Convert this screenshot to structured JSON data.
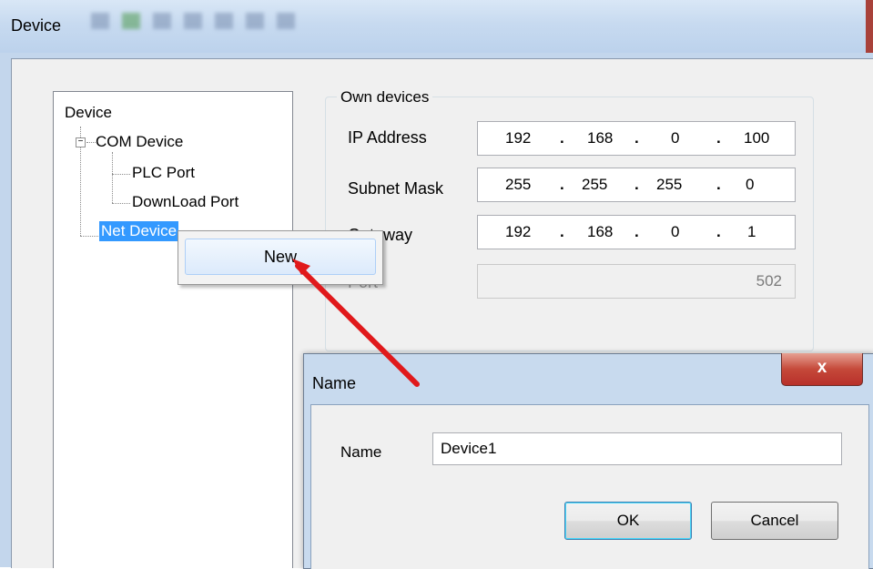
{
  "window": {
    "title": "Device"
  },
  "tree": {
    "root": "Device",
    "com_device": "COM Device",
    "plc_port": "PLC Port",
    "download_port": "DownLoad Port",
    "net_device": "Net Device"
  },
  "context_menu": {
    "new_label": "New"
  },
  "own_devices": {
    "legend": "Own devices",
    "ip_label": "IP Address",
    "ip": [
      "192",
      "168",
      "0",
      "100"
    ],
    "subnet_label": "Subnet Mask",
    "subnet": [
      "255",
      "255",
      "255",
      "0"
    ],
    "gateway_label": "Gateway",
    "gateway": [
      "192",
      "168",
      "0",
      "1"
    ],
    "port_label": "Port",
    "port": "502"
  },
  "name_dialog": {
    "title": "Name",
    "close_glyph": "x",
    "field_label": "Name",
    "field_value": "Device1",
    "ok_label": "OK",
    "cancel_label": "Cancel"
  },
  "colors": {
    "selection": "#3399ff",
    "annotation_arrow": "#e0191b"
  }
}
